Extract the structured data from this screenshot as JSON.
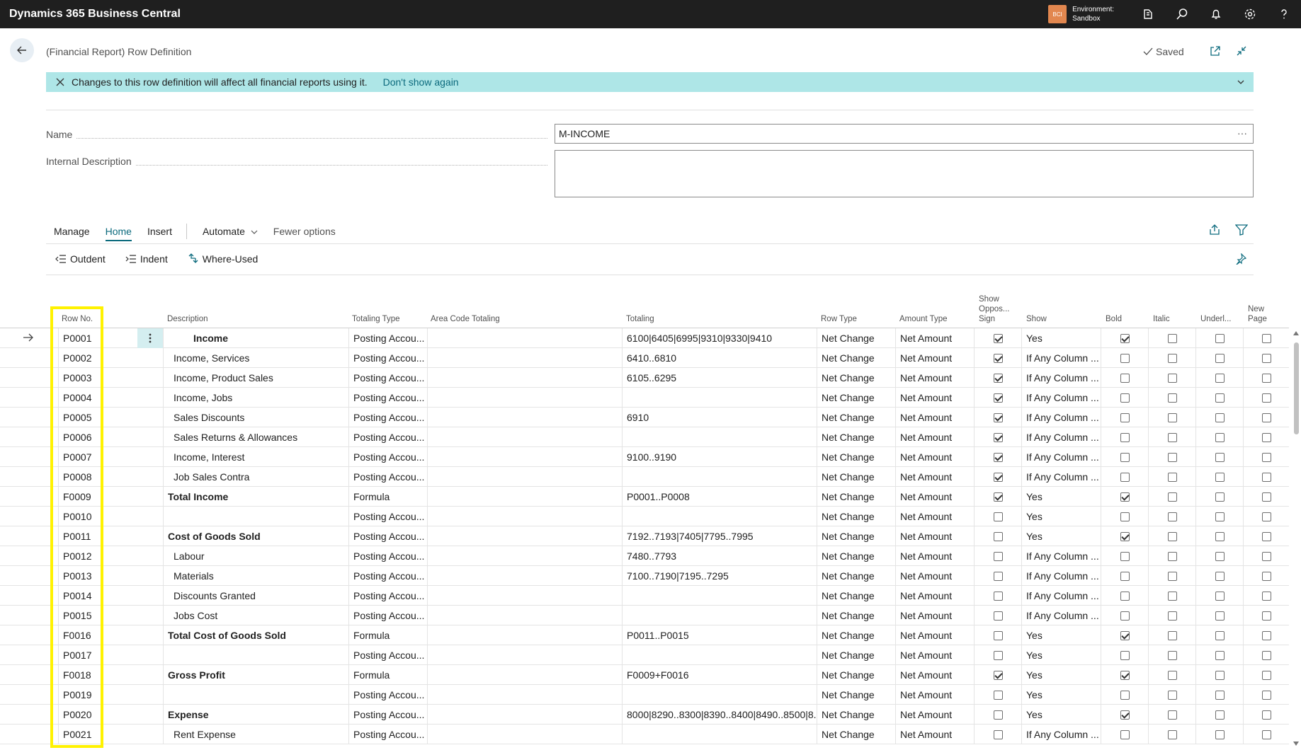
{
  "app": {
    "title": "Dynamics 365 Business Central",
    "env_badge": "BCI",
    "env_label": "Environment:",
    "env_name": "Sandbox"
  },
  "header": {
    "page_title": "(Financial Report) Row Definition",
    "saved_label": "Saved"
  },
  "banner": {
    "message": "Changes to this row definition will affect all financial reports using it.",
    "link": "Don't show again"
  },
  "fields": {
    "name_label": "Name",
    "name_value": "M-INCOME",
    "name_ellipsis": "···",
    "desc_label": "Internal Description",
    "desc_value": ""
  },
  "actions": {
    "manage": "Manage",
    "home": "Home",
    "insert": "Insert",
    "automate": "Automate",
    "fewer": "Fewer options",
    "outdent": "Outdent",
    "indent": "Indent",
    "where_used": "Where-Used"
  },
  "columns": {
    "row_no": "Row No.",
    "description": "Description",
    "totaling_type": "Totaling Type",
    "area_code": "Area Code Totaling",
    "totaling": "Totaling",
    "row_type": "Row Type",
    "amount_type": "Amount Type",
    "show_opp": [
      "Show",
      "Oppos...",
      "Sign"
    ],
    "show": "Show",
    "bold": "Bold",
    "italic": "Italic",
    "underline": "Underl...",
    "new_page": [
      "New",
      "Page"
    ]
  },
  "rows": [
    {
      "no": "P0001",
      "desc": "Income",
      "indent": 0,
      "bold": true,
      "ttype": "Posting Accou...",
      "tot": "6100|6405|6995|9310|9330|9410",
      "rtype": "Net Change",
      "atype": "Net Amount",
      "opp": true,
      "show": "Yes",
      "b": true,
      "i": false,
      "u": false,
      "np": false
    },
    {
      "no": "P0002",
      "desc": "Income, Services",
      "indent": 1,
      "bold": false,
      "ttype": "Posting Accou...",
      "tot": "6410..6810",
      "rtype": "Net Change",
      "atype": "Net Amount",
      "opp": true,
      "show": "If Any Column ...",
      "b": false,
      "i": false,
      "u": false,
      "np": false
    },
    {
      "no": "P0003",
      "desc": "Income, Product Sales",
      "indent": 1,
      "bold": false,
      "ttype": "Posting Accou...",
      "tot": "6105..6295",
      "rtype": "Net Change",
      "atype": "Net Amount",
      "opp": true,
      "show": "If Any Column ...",
      "b": false,
      "i": false,
      "u": false,
      "np": false
    },
    {
      "no": "P0004",
      "desc": "Income, Jobs",
      "indent": 1,
      "bold": false,
      "ttype": "Posting Accou...",
      "tot": "",
      "rtype": "Net Change",
      "atype": "Net Amount",
      "opp": true,
      "show": "If Any Column ...",
      "b": false,
      "i": false,
      "u": false,
      "np": false
    },
    {
      "no": "P0005",
      "desc": "Sales Discounts",
      "indent": 1,
      "bold": false,
      "ttype": "Posting Accou...",
      "tot": "6910",
      "rtype": "Net Change",
      "atype": "Net Amount",
      "opp": true,
      "show": "If Any Column ...",
      "b": false,
      "i": false,
      "u": false,
      "np": false
    },
    {
      "no": "P0006",
      "desc": "Sales Returns & Allowances",
      "indent": 1,
      "bold": false,
      "ttype": "Posting Accou...",
      "tot": "",
      "rtype": "Net Change",
      "atype": "Net Amount",
      "opp": true,
      "show": "If Any Column ...",
      "b": false,
      "i": false,
      "u": false,
      "np": false
    },
    {
      "no": "P0007",
      "desc": "Income, Interest",
      "indent": 1,
      "bold": false,
      "ttype": "Posting Accou...",
      "tot": "9100..9190",
      "rtype": "Net Change",
      "atype": "Net Amount",
      "opp": true,
      "show": "If Any Column ...",
      "b": false,
      "i": false,
      "u": false,
      "np": false
    },
    {
      "no": "P0008",
      "desc": "Job Sales Contra",
      "indent": 1,
      "bold": false,
      "ttype": "Posting Accou...",
      "tot": "",
      "rtype": "Net Change",
      "atype": "Net Amount",
      "opp": true,
      "show": "If Any Column ...",
      "b": false,
      "i": false,
      "u": false,
      "np": false
    },
    {
      "no": "F0009",
      "desc": "Total Income",
      "indent": 0,
      "bold": true,
      "ttype": "Formula",
      "tot": "P0001..P0008",
      "rtype": "Net Change",
      "atype": "Net Amount",
      "opp": true,
      "show": "Yes",
      "b": true,
      "i": false,
      "u": false,
      "np": false
    },
    {
      "no": "P0010",
      "desc": "",
      "indent": 0,
      "bold": false,
      "ttype": "Posting Accou...",
      "tot": "",
      "rtype": "Net Change",
      "atype": "Net Amount",
      "opp": false,
      "show": "Yes",
      "b": false,
      "i": false,
      "u": false,
      "np": false
    },
    {
      "no": "P0011",
      "desc": "Cost of Goods Sold",
      "indent": 0,
      "bold": true,
      "ttype": "Posting Accou...",
      "tot": "7192..7193|7405|7795..7995",
      "rtype": "Net Change",
      "atype": "Net Amount",
      "opp": false,
      "show": "Yes",
      "b": true,
      "i": false,
      "u": false,
      "np": false
    },
    {
      "no": "P0012",
      "desc": "Labour",
      "indent": 1,
      "bold": false,
      "ttype": "Posting Accou...",
      "tot": "7480..7793",
      "rtype": "Net Change",
      "atype": "Net Amount",
      "opp": false,
      "show": "If Any Column ...",
      "b": false,
      "i": false,
      "u": false,
      "np": false
    },
    {
      "no": "P0013",
      "desc": "Materials",
      "indent": 1,
      "bold": false,
      "ttype": "Posting Accou...",
      "tot": "7100..7190|7195..7295",
      "rtype": "Net Change",
      "atype": "Net Amount",
      "opp": false,
      "show": "If Any Column ...",
      "b": false,
      "i": false,
      "u": false,
      "np": false
    },
    {
      "no": "P0014",
      "desc": "Discounts Granted",
      "indent": 1,
      "bold": false,
      "ttype": "Posting Accou...",
      "tot": "",
      "rtype": "Net Change",
      "atype": "Net Amount",
      "opp": false,
      "show": "If Any Column ...",
      "b": false,
      "i": false,
      "u": false,
      "np": false
    },
    {
      "no": "P0015",
      "desc": "Jobs Cost",
      "indent": 1,
      "bold": false,
      "ttype": "Posting Accou...",
      "tot": "",
      "rtype": "Net Change",
      "atype": "Net Amount",
      "opp": false,
      "show": "If Any Column ...",
      "b": false,
      "i": false,
      "u": false,
      "np": false
    },
    {
      "no": "F0016",
      "desc": "Total Cost of Goods Sold",
      "indent": 0,
      "bold": true,
      "ttype": "Formula",
      "tot": "P0011..P0015",
      "rtype": "Net Change",
      "atype": "Net Amount",
      "opp": false,
      "show": "Yes",
      "b": true,
      "i": false,
      "u": false,
      "np": false
    },
    {
      "no": "P0017",
      "desc": "",
      "indent": 0,
      "bold": false,
      "ttype": "Posting Accou...",
      "tot": "",
      "rtype": "Net Change",
      "atype": "Net Amount",
      "opp": false,
      "show": "Yes",
      "b": false,
      "i": false,
      "u": false,
      "np": false
    },
    {
      "no": "F0018",
      "desc": "Gross Profit",
      "indent": 0,
      "bold": true,
      "ttype": "Formula",
      "tot": "F0009+F0016",
      "rtype": "Net Change",
      "atype": "Net Amount",
      "opp": true,
      "show": "Yes",
      "b": true,
      "i": false,
      "u": false,
      "np": false
    },
    {
      "no": "P0019",
      "desc": "",
      "indent": 0,
      "bold": false,
      "ttype": "Posting Accou...",
      "tot": "",
      "rtype": "Net Change",
      "atype": "Net Amount",
      "opp": false,
      "show": "Yes",
      "b": false,
      "i": false,
      "u": false,
      "np": false
    },
    {
      "no": "P0020",
      "desc": "Expense",
      "indent": 0,
      "bold": true,
      "ttype": "Posting Accou...",
      "tot": "8000|8290..8300|8390..8400|8490..8500|8...",
      "rtype": "Net Change",
      "atype": "Net Amount",
      "opp": false,
      "show": "Yes",
      "b": true,
      "i": false,
      "u": false,
      "np": false
    },
    {
      "no": "P0021",
      "desc": "Rent Expense",
      "indent": 1,
      "bold": false,
      "ttype": "Posting Accou...",
      "tot": "",
      "rtype": "Net Change",
      "atype": "Net Amount",
      "opp": false,
      "show": "If Any Column ...",
      "b": false,
      "i": false,
      "u": false,
      "np": false
    }
  ],
  "colors": {
    "accent": "#0b6a7d",
    "banner": "#aee6e7",
    "highlight": "#fff200",
    "topbar": "#1f1f1f"
  }
}
